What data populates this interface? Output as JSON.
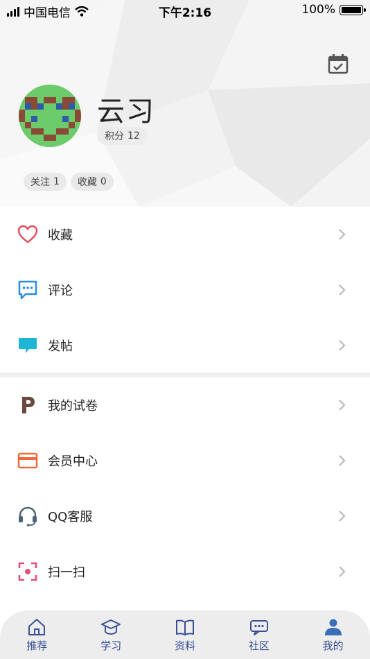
{
  "status_bar": {
    "carrier": "中国电信",
    "time": "下午2:16",
    "battery_percent": "100%",
    "battery_level": 1.0
  },
  "profile": {
    "username": "云习",
    "points_label": "积分",
    "points_value": "12",
    "follow_label": "关注",
    "follow_count": "1",
    "favorites_label": "收藏",
    "favorites_count": "0"
  },
  "menu_group_1": [
    {
      "label": "收藏",
      "icon": "heart-icon"
    },
    {
      "label": "评论",
      "icon": "comment-icon"
    },
    {
      "label": "发帖",
      "icon": "post-icon"
    }
  ],
  "menu_group_2": [
    {
      "label": "我的试卷",
      "icon": "paper-icon"
    },
    {
      "label": "会员中心",
      "icon": "card-icon"
    },
    {
      "label": "QQ客服",
      "icon": "headset-icon"
    },
    {
      "label": "扫一扫",
      "icon": "scan-icon"
    }
  ],
  "tabs": [
    {
      "label": "推荐",
      "icon": "home-icon",
      "active": false
    },
    {
      "label": "学习",
      "icon": "graduation-cap-icon",
      "active": false
    },
    {
      "label": "资料",
      "icon": "book-icon",
      "active": false
    },
    {
      "label": "社区",
      "icon": "chat-bubble-icon",
      "active": false
    },
    {
      "label": "我的",
      "icon": "user-icon",
      "active": true
    }
  ],
  "colors": {
    "heart": "#e0505e",
    "comment": "#2a8ee0",
    "post": "#1fb5d6",
    "paper": "#6b4a3e",
    "card": "#f06a3a",
    "headset": "#4b6578",
    "scan": "#e0507a",
    "tab_blue": "#3a4f96"
  }
}
